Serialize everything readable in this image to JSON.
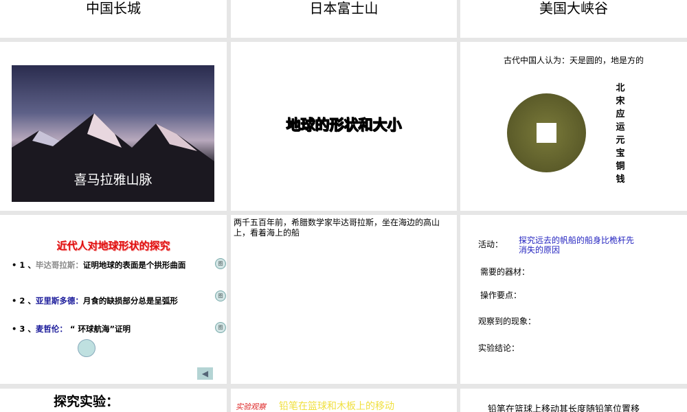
{
  "slides": {
    "s1": {
      "title": "中国长城"
    },
    "s2": {
      "title": "日本富士山"
    },
    "s3": {
      "title": "美国大峡谷"
    },
    "s4": {
      "caption": "喜马拉雅山脉"
    },
    "s5": {
      "title": "地球的形状和大小"
    },
    "s6": {
      "heading": "古代中国人认为：天是圆的，地是方的",
      "vertical_caption": [
        "北",
        "宋",
        "应",
        "运",
        "元",
        "宝",
        "铜",
        "钱"
      ]
    },
    "s7": {
      "title": "近代人对地球形状的探究",
      "items": [
        {
          "num": "1 、",
          "name": "毕达哥拉斯：",
          "text": "证明地球的表面是个拱形曲面",
          "btn": "图"
        },
        {
          "num": "2 、",
          "name": "亚里斯多德：",
          "text": "月食的缺损部分总是呈弧形",
          "btn": "图"
        },
        {
          "num": "3 、",
          "name": "麦哲伦：",
          "text": " “ 环球航海”证明",
          "btn": "图"
        }
      ]
    },
    "s8": {
      "text": "两千五百年前，希腊数学家毕达哥拉斯，坐在海边的高山上，看着海上的船"
    },
    "s9": {
      "activity_label": "活动：",
      "activity_text": "探究远去的帆船的船身比桅杆先消失的原因",
      "materials": "需要的器材：",
      "points": "操作要点：",
      "observed": "观察到的现象：",
      "conclusion": "实验结论："
    },
    "s10": {
      "title": "探究实验："
    },
    "s11": {
      "stamp": "实验观察",
      "title": "铅笔在篮球和木板上的移动"
    },
    "s12": {
      "text": "铅笔在篮球上移动其长度随铅笔位置移"
    }
  }
}
